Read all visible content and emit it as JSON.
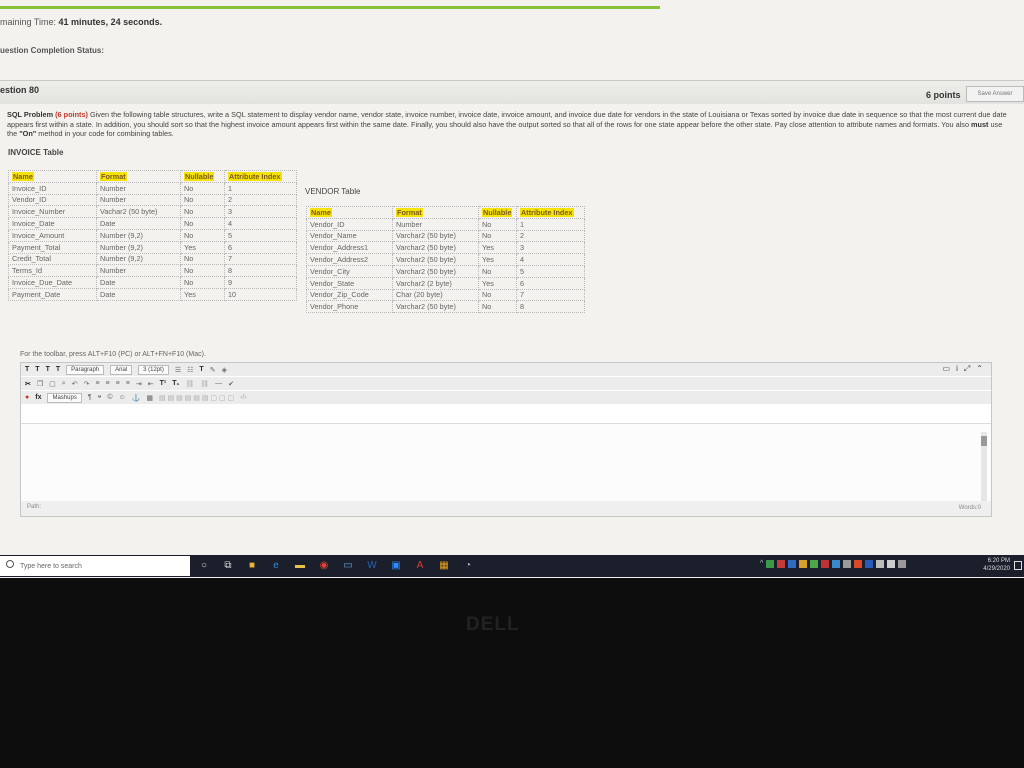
{
  "header": {
    "timer_label": "maining Time:",
    "timer_value": "41 minutes, 24 seconds.",
    "completion_label": "uestion Completion Status:"
  },
  "question": {
    "number": "estion 80",
    "points": "6 points",
    "save_label": "Save Answer"
  },
  "problem": {
    "title": "SQL Problem",
    "points_tag": "(6 points)",
    "text_before_on": "Given the following table structures, write a SQL statement to display vendor name, vendor state, invoice number, invoice date, invoice amount, and invoice due date for vendors in the state of Louisiana or Texas sorted by invoice due date in sequence so that the most current due date appears first within a state. In addition, you should sort so that the highest invoice amount appears first within the same date. Finally, you should also have the output sorted so that all of the rows for one state appear before the other state. Pay close attention to attribute names and formats. You also",
    "must_word": "must",
    "use_the": "use the",
    "on_word": "\"On\"",
    "text_after_on": "method in your code for combining tables."
  },
  "invoice_table": {
    "title": "INVOICE Table",
    "headers": [
      "Name",
      "Format",
      "Nullable",
      "Attribute Index"
    ],
    "rows": [
      [
        "Invoice_ID",
        "Number",
        "No",
        "1"
      ],
      [
        "Vendor_ID",
        "Number",
        "No",
        "2"
      ],
      [
        "Invoice_Number",
        "Vachar2 (50 byte)",
        "No",
        "3"
      ],
      [
        "Invoice_Date",
        "Date",
        "No",
        "4"
      ],
      [
        "Invoice_Amount",
        "Number (9,2)",
        "No",
        "5"
      ],
      [
        "Payment_Total",
        "Number (9,2)",
        "Yes",
        "6"
      ],
      [
        "Credit_Total",
        "Number (9,2)",
        "No",
        "7"
      ],
      [
        "Terms_Id",
        "Number",
        "No",
        "8"
      ],
      [
        "Invoice_Due_Date",
        "Date",
        "No",
        "9"
      ],
      [
        "Payment_Date",
        "Date",
        "Yes",
        "10"
      ]
    ]
  },
  "vendor_table": {
    "title": "VENDOR Table",
    "headers": [
      "Name",
      "Format",
      "Nullable",
      "Attribute Index"
    ],
    "rows": [
      [
        "Vendor_ID",
        "Number",
        "No",
        "1"
      ],
      [
        "Vendor_Name",
        "Varchar2 (50 byte)",
        "No",
        "2"
      ],
      [
        "Vendor_Address1",
        "Varchar2 (50 byte)",
        "Yes",
        "3"
      ],
      [
        "Vendor_Address2",
        "Varchar2 (50 byte)",
        "Yes",
        "4"
      ],
      [
        "Vendor_City",
        "Varchar2 (50 byte)",
        "No",
        "5"
      ],
      [
        "Vendor_State",
        "Varchar2 (2 byte)",
        "Yes",
        "6"
      ],
      [
        "Vendor_Zip_Code",
        "Char (20 byte)",
        "No",
        "7"
      ],
      [
        "Vendor_Phone",
        "Varchar2 (50 byte)",
        "No",
        "8"
      ]
    ]
  },
  "editor": {
    "hint": "For the toolbar, press ALT+F10 (PC) or ALT+FN+F10 (Mac).",
    "paragraph": "Paragraph",
    "font": "Arial",
    "size": "3 (12pt)",
    "mashups": "Mashups",
    "path_label": "Path:",
    "words_label": "Words:0"
  },
  "taskbar": {
    "search_placeholder": "Type here to search",
    "time": "6:20 PM",
    "date": "4/29/2020"
  },
  "monitor": {
    "brand": "DELL"
  },
  "colors": {
    "progress": "#86c33a",
    "header_highlight": "#f5e20a",
    "points_red": "#c0392b",
    "taskbar": "#1a1f2b"
  }
}
